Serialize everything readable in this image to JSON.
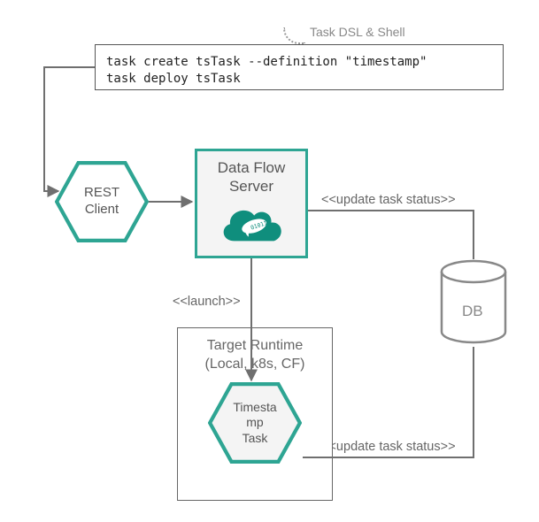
{
  "annotation": "Task  DSL & Shell",
  "code": {
    "line1": "task create tsTask --definition \"timestamp\"",
    "line2": "task deploy tsTask"
  },
  "rest_client": "REST\nClient",
  "server": {
    "title": "Data Flow\nServer",
    "logo_name": "spring-cloud-logo"
  },
  "labels": {
    "update1": "<<update task status>>",
    "launch": "<<launch>>",
    "update2": "<<update task status>>"
  },
  "runtime": {
    "title": "Target Runtime\n(Local, k8s, CF)",
    "task": "Timesta\nmp\nTask"
  },
  "db": "DB",
  "colors": {
    "accent": "#2ea593",
    "line": "#6f6f6f"
  }
}
